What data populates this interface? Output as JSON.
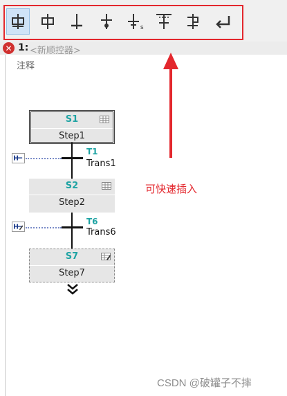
{
  "toolbar": {
    "buttons": [
      {
        "name": "insert-step-transition",
        "icon": "step-transition-icon"
      },
      {
        "name": "insert-step",
        "icon": "step-icon"
      },
      {
        "name": "insert-transition",
        "icon": "transition-icon"
      },
      {
        "name": "insert-jump",
        "icon": "jump-icon"
      },
      {
        "name": "insert-step-sequence",
        "icon": "sequence-icon"
      },
      {
        "name": "insert-branch-open",
        "icon": "branch-open-icon"
      },
      {
        "name": "insert-branch-close",
        "icon": "branch-close-icon"
      },
      {
        "name": "insert-return",
        "icon": "return-icon"
      }
    ],
    "sequence_subscript": "s"
  },
  "network": {
    "number": "1:",
    "name": "<新顺控器>",
    "comment": "注释"
  },
  "steps": [
    {
      "id": "S1",
      "label": "Step1"
    },
    {
      "id": "S2",
      "label": "Step2"
    },
    {
      "id": "S7",
      "label": "Step7"
    }
  ],
  "transitions": [
    {
      "id": "T1",
      "label": "Trans1"
    },
    {
      "id": "T6",
      "label": "Trans6"
    }
  ],
  "annotation": {
    "text": "可快速插入"
  },
  "watermark": "CSDN @破罐子不摔",
  "colors": {
    "accent_red": "#e3272d",
    "step_name_teal": "#1ea3a3",
    "error_red": "#d0302f",
    "toolbar_active": "#cfe3f7"
  }
}
